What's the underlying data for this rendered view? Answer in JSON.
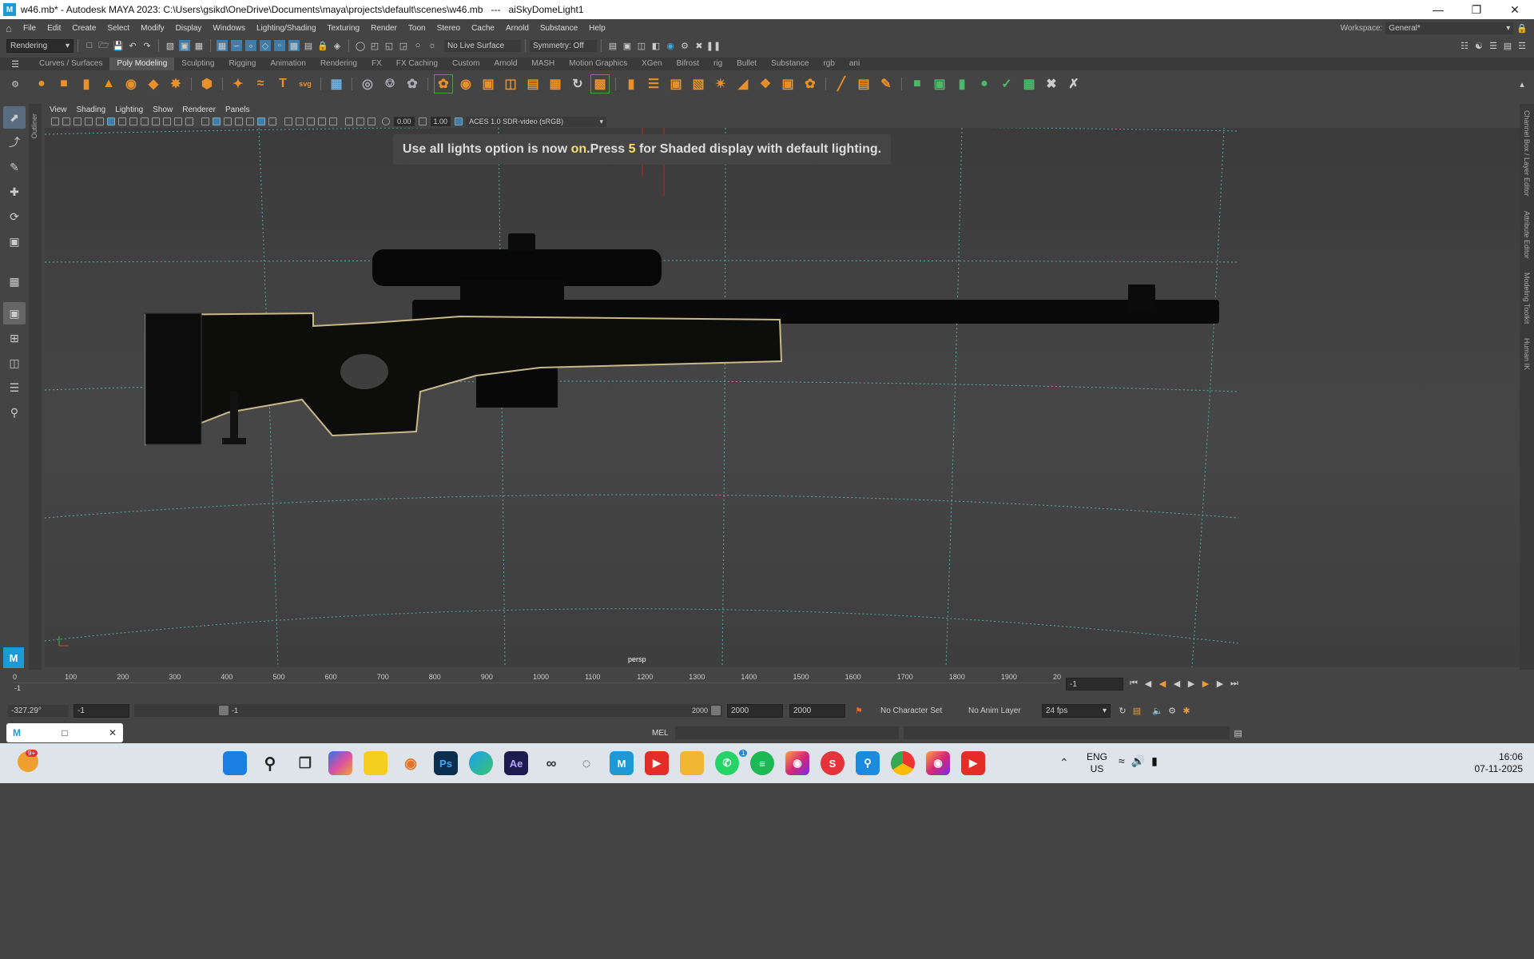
{
  "titlebar": {
    "title": "w46.mb* - Autodesk MAYA 2023: C:\\Users\\gsikd\\OneDrive\\Documents\\maya\\projects\\default\\scenes\\w46.mb   ---   aiSkyDomeLight1",
    "logo": "M"
  },
  "menubar": {
    "items": [
      "File",
      "Edit",
      "Create",
      "Select",
      "Modify",
      "Display",
      "Windows",
      "Lighting/Shading",
      "Texturing",
      "Render",
      "Toon",
      "Stereo",
      "Cache",
      "Arnold",
      "Substance",
      "Help"
    ],
    "workspace_label": "Workspace:",
    "workspace_value": "General*"
  },
  "statusline": {
    "menuset": "Rendering",
    "live_surface": "No Live Surface",
    "symmetry": "Symmetry: Off"
  },
  "shelf": {
    "tabs": [
      "Curves / Surfaces",
      "Poly Modeling",
      "Sculpting",
      "Rigging",
      "Animation",
      "Rendering",
      "FX",
      "FX Caching",
      "Custom",
      "Arnold",
      "MASH",
      "Motion Graphics",
      "XGen",
      "Bifrost",
      "rig",
      "Bullet",
      "Substance",
      "rgb",
      "ani"
    ],
    "active_tab": "Poly Modeling"
  },
  "panel": {
    "menus": [
      "View",
      "Shading",
      "Lighting",
      "Show",
      "Renderer",
      "Panels"
    ],
    "exposure": "0.00",
    "gamma": "1.00",
    "color_space": "ACES 1.0 SDR-video (sRGB)"
  },
  "side": {
    "outliner": "Outliner",
    "right": [
      "Channel Box / Layer Editor",
      "Attribute Editor",
      "Modeling Toolkit",
      "Human IK"
    ]
  },
  "viewport": {
    "hud_pre": "Use all lights option is now ",
    "hud_on": "on",
    "hud_mid": ".Press ",
    "hud_num": "5",
    "hud_post": " for Shaded display with default lighting.",
    "camera": "persp"
  },
  "timeline": {
    "ticks": [
      "0",
      "100",
      "200",
      "300",
      "400",
      "500",
      "600",
      "700",
      "800",
      "900",
      "1000",
      "1100",
      "1200",
      "1300",
      "1400",
      "1500",
      "1600",
      "1700",
      "1800",
      "1900",
      "20"
    ],
    "current": "-1",
    "current_field": "-1"
  },
  "range": {
    "readout": "-327.29°",
    "start": "-1",
    "slider_start": "-1",
    "slider_end": "2000",
    "end1": "2000",
    "end2": "2000",
    "character_set": "No Character Set",
    "anim_layer": "No Anim Layer",
    "fps": "24 fps"
  },
  "cmd": {
    "lang": "MEL"
  },
  "taskbar": {
    "badge": "9+",
    "whatsapp_badge": "1",
    "lang1": "ENG",
    "lang2": "US",
    "time": "16:06",
    "date": "07-11-2025"
  }
}
